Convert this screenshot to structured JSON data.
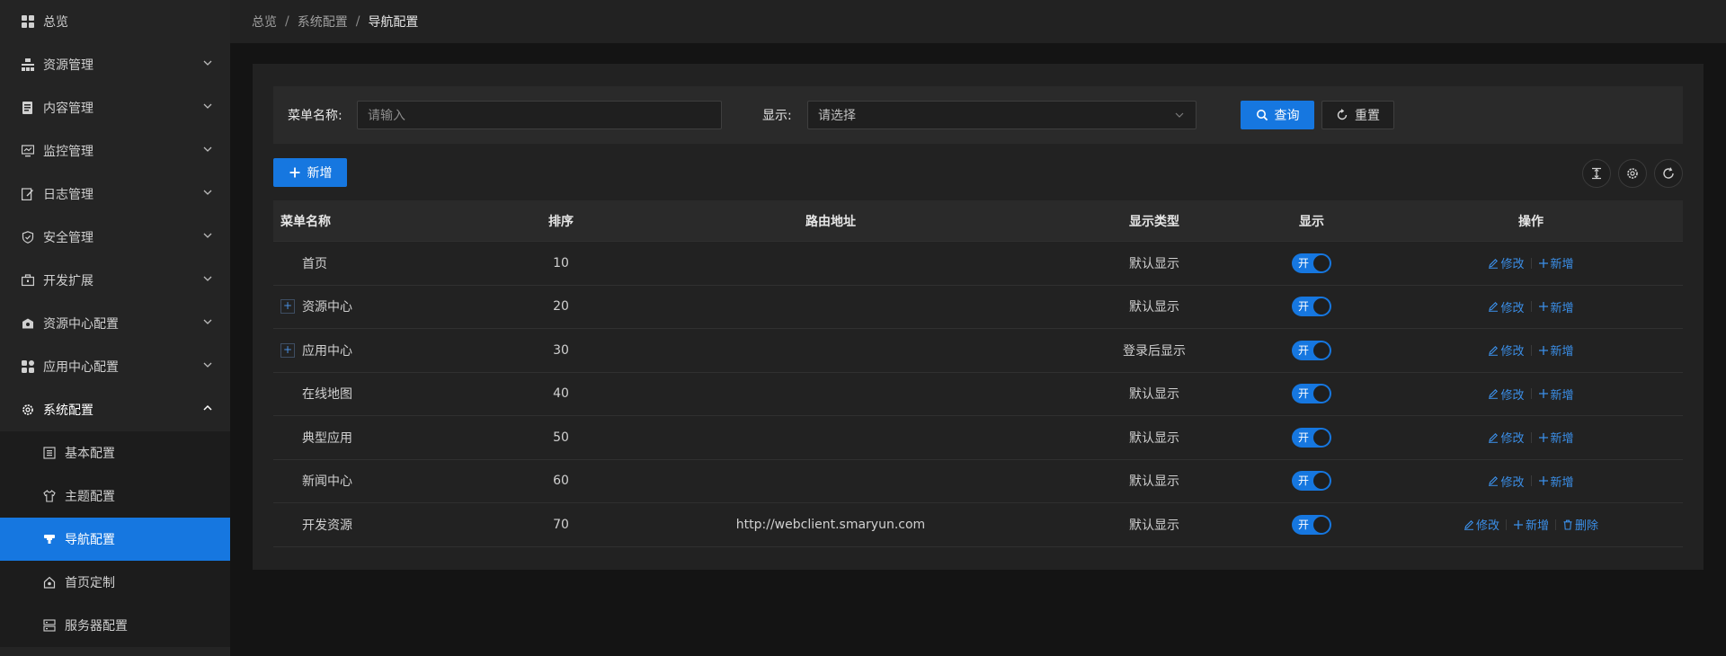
{
  "breadcrumb": [
    "总览",
    "系统配置",
    "导航配置"
  ],
  "sidebar": {
    "items": [
      {
        "label": "总览",
        "icon": "dashboard-icon"
      },
      {
        "label": "资源管理",
        "icon": "resource-icon"
      },
      {
        "label": "内容管理",
        "icon": "content-icon"
      },
      {
        "label": "监控管理",
        "icon": "monitor-icon"
      },
      {
        "label": "日志管理",
        "icon": "log-icon"
      },
      {
        "label": "安全管理",
        "icon": "shield-icon"
      },
      {
        "label": "开发扩展",
        "icon": "toolbox-icon"
      },
      {
        "label": "资源中心配置",
        "icon": "resource-center-icon"
      },
      {
        "label": "应用中心配置",
        "icon": "apps-icon"
      },
      {
        "label": "系统配置",
        "icon": "gear-icon"
      }
    ],
    "sub_items": [
      {
        "label": "基本配置",
        "icon": "basic-config-icon"
      },
      {
        "label": "主题配置",
        "icon": "shirt-icon"
      },
      {
        "label": "导航配置",
        "icon": "nav-icon"
      },
      {
        "label": "首页定制",
        "icon": "home-icon"
      },
      {
        "label": "服务器配置",
        "icon": "server-icon"
      }
    ]
  },
  "filter": {
    "name_label": "菜单名称:",
    "name_placeholder": "请输入",
    "show_label": "显示:",
    "show_placeholder": "请选择",
    "query_button": "查询",
    "reset_button": "重置"
  },
  "toolbar": {
    "add_button": "新增"
  },
  "table": {
    "headers": {
      "name": "菜单名称",
      "sort": "排序",
      "route": "路由地址",
      "type": "显示类型",
      "show": "显示",
      "op": "操作"
    },
    "rows": [
      {
        "name": "首页",
        "sort": "10",
        "route": "",
        "type": "默认显示",
        "show": "开",
        "expandable": false,
        "edit": "修改",
        "add": "新增"
      },
      {
        "name": "资源中心",
        "sort": "20",
        "route": "",
        "type": "默认显示",
        "show": "开",
        "expandable": true,
        "edit": "修改",
        "add": "新增"
      },
      {
        "name": "应用中心",
        "sort": "30",
        "route": "",
        "type": "登录后显示",
        "show": "开",
        "expandable": true,
        "edit": "修改",
        "add": "新增"
      },
      {
        "name": "在线地图",
        "sort": "40",
        "route": "",
        "type": "默认显示",
        "show": "开",
        "expandable": false,
        "edit": "修改",
        "add": "新增"
      },
      {
        "name": "典型应用",
        "sort": "50",
        "route": "",
        "type": "默认显示",
        "show": "开",
        "expandable": false,
        "edit": "修改",
        "add": "新增"
      },
      {
        "name": "新闻中心",
        "sort": "60",
        "route": "",
        "type": "默认显示",
        "show": "开",
        "expandable": false,
        "edit": "修改",
        "add": "新增"
      },
      {
        "name": "开发资源",
        "sort": "70",
        "route": "http://webclient.smaryun.com",
        "type": "默认显示",
        "show": "开",
        "expandable": false,
        "edit": "修改",
        "add": "新增",
        "delete": "删除"
      }
    ]
  },
  "colors": {
    "accent": "#1677e0",
    "link": "#3b8fe8",
    "sidebar_bg": "#242424",
    "page_bg": "#141414"
  }
}
